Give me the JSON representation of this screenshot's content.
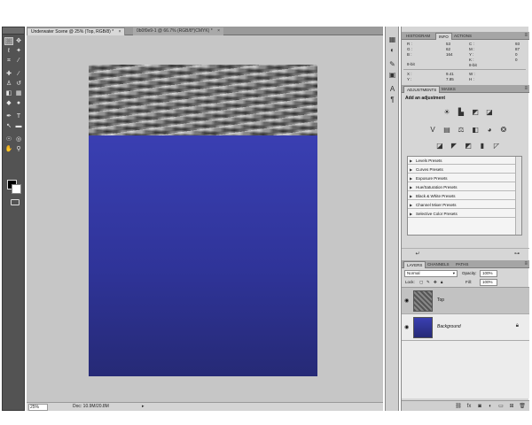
{
  "document_tabs": [
    {
      "label": "Underwater Scene @ 25% (Top, RGB/8) *",
      "close": "×"
    },
    {
      "label": "0b0f0e9-1 @ 66.7% (RGB/8*)CMYK) *",
      "close": "×"
    }
  ],
  "status": {
    "zoom": "25%",
    "doc_size": "Doc: 10.9M/20.8M",
    "arrow": "▸"
  },
  "panels": {
    "info": {
      "tabs": [
        "Histogram",
        "Info",
        "Actions"
      ],
      "rgb": {
        "r_label": "R :",
        "r": "53",
        "g_label": "G :",
        "g": "62",
        "b_label": "B :",
        "b": "164"
      },
      "cmyk": {
        "c_label": "C :",
        "c": "93",
        "m_label": "M :",
        "m": "87",
        "y_label": "Y :",
        "y": "0",
        "k_label": "K :",
        "k": "0"
      },
      "bit_depth_left": "8-bit",
      "bit_depth_right": "8-bit",
      "xy": {
        "x_label": "X :",
        "x": "9.41",
        "y_label": "Y :",
        "y": "7.85"
      },
      "wh": {
        "w_label": "W :",
        "h_label": "H :"
      }
    },
    "adjustments": {
      "tabs": [
        "Adjustments",
        "Masks"
      ],
      "title": "Add an adjustment",
      "presets": [
        "Levels Presets",
        "Curves Presets",
        "Exposure Presets",
        "Hue/Saturation Presets",
        "Black & White Presets",
        "Channel Mixer Presets",
        "Selective Color Presets"
      ]
    },
    "layers": {
      "tabs": [
        "Layers",
        "Channels",
        "Paths"
      ],
      "blend_mode": "Normal",
      "opacity_label": "Opacity:",
      "opacity": "100%",
      "lock_label": "Lock:",
      "fill_label": "Fill:",
      "fill": "100%",
      "items": [
        {
          "name": "Top",
          "selected": true
        },
        {
          "name": "Background",
          "selected": false
        }
      ]
    }
  },
  "colors": {
    "water_top": "#3a3fb2",
    "water_bottom": "#262a76",
    "canvas_bg": "#c6c6c6",
    "toolbox_bg": "#535353"
  }
}
